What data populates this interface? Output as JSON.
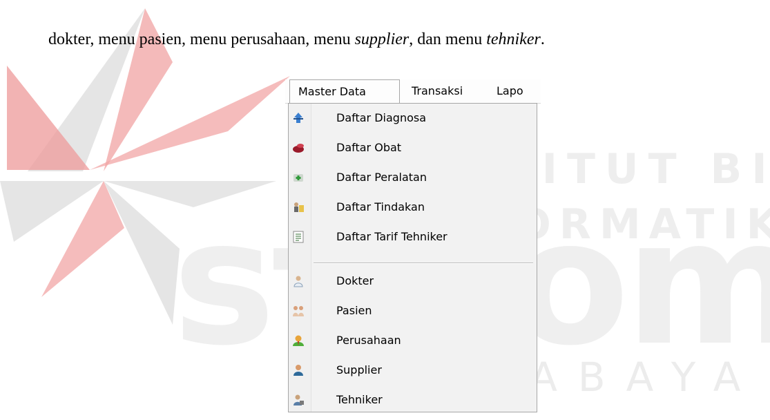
{
  "caption": {
    "text1": "dokter, menu pasien, menu perusahaan, menu ",
    "em1": "supplier",
    "text2": ", dan menu ",
    "em2": "tehniker",
    "text3": "."
  },
  "watermark": {
    "institut": "INSTITUT BISNIS",
    "informatika": "& INFORMATIKA",
    "stikom": "stikom",
    "surabaya": "SURABAYA"
  },
  "menubar": {
    "items": [
      "Master Data",
      "Transaksi",
      "Lapo"
    ]
  },
  "dropdown": {
    "items": [
      {
        "label": "Daftar Diagnosa",
        "icon": "diagnosis-icon"
      },
      {
        "label": "Daftar Obat",
        "icon": "medicine-icon"
      },
      {
        "label": "Daftar Peralatan",
        "icon": "equipment-icon"
      },
      {
        "label": "Daftar Tindakan",
        "icon": "action-icon"
      },
      {
        "label": "Daftar Tarif Tehniker",
        "icon": "tariff-list-icon"
      },
      {
        "label": "Dokter",
        "icon": "doctor-icon"
      },
      {
        "label": "Pasien",
        "icon": "patients-icon"
      },
      {
        "label": "Perusahaan",
        "icon": "company-icon"
      },
      {
        "label": "Supplier",
        "icon": "supplier-icon"
      },
      {
        "label": "Tehniker",
        "icon": "technician-icon"
      }
    ]
  }
}
